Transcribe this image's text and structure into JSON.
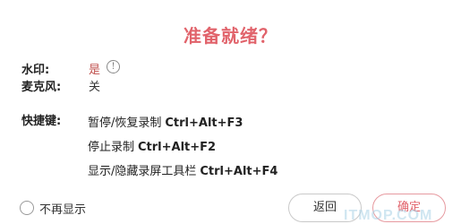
{
  "dialog": {
    "title": "准备就绪？"
  },
  "settings": {
    "watermark_label": "水印:",
    "watermark_value": "是",
    "watermark_info_icon": "info-icon",
    "mic_label": "麦克风:",
    "mic_value": "关"
  },
  "shortcuts": {
    "label": "快捷键:",
    "items": [
      {
        "action": "暂停/恢复录制",
        "keys": "Ctrl+Alt+F3"
      },
      {
        "action": "停止录制",
        "keys": "Ctrl+Alt+F2"
      },
      {
        "action": "显示/隐藏录屏工具栏",
        "keys": "Ctrl+Alt+F4"
      }
    ]
  },
  "footer": {
    "dont_show_label": "不再显示",
    "back_label": "返回",
    "ok_label": "确定",
    "watermark_text": "ITMOP.COM"
  },
  "colors": {
    "accent": "#e1636b",
    "watermark_value": "#c0504d"
  }
}
